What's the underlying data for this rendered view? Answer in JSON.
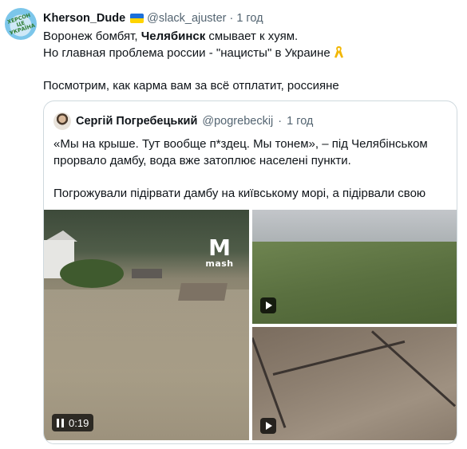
{
  "tweet": {
    "author_name": "Kherson_Dude",
    "author_flag": "🇺🇦",
    "handle": "@slack_ajuster",
    "separator": "·",
    "time": "1 год",
    "avatar_text": "ХЕРСОН ЦЕ УКРАЇНА",
    "lines": {
      "l1_a": "Воронеж бомбят, ",
      "l1_b": "Челябинск",
      "l1_c": " смывает к хуям.",
      "l2": "Но главная проблема россии - \"нацисты\" в Украине",
      "l3": "Посмотрим, как карма вам за всё отплатит, россияне"
    },
    "emoji_icon": "yellow-ribbon-icon"
  },
  "quote": {
    "author_name": "Сергій Погребецький",
    "handle": "@pogrebeckij",
    "separator": "·",
    "time": "1 год",
    "lines": {
      "l1": "«Мы на крыше. Тут вообще п*здец. Мы тонем», – під Челябінськом",
      "l2": "прорвало дамбу, вода вже затоплює населені пункти.",
      "l3": "Погрожували підірвати дамбу на київському морі, а підірвали свою"
    },
    "media": {
      "main_video": {
        "logo_mark": "M",
        "logo_word": "mash",
        "duration": "0:19",
        "state_icon": "pause-icon"
      },
      "top_right_icon": "play-icon",
      "bottom_right_icon": "play-icon"
    }
  }
}
